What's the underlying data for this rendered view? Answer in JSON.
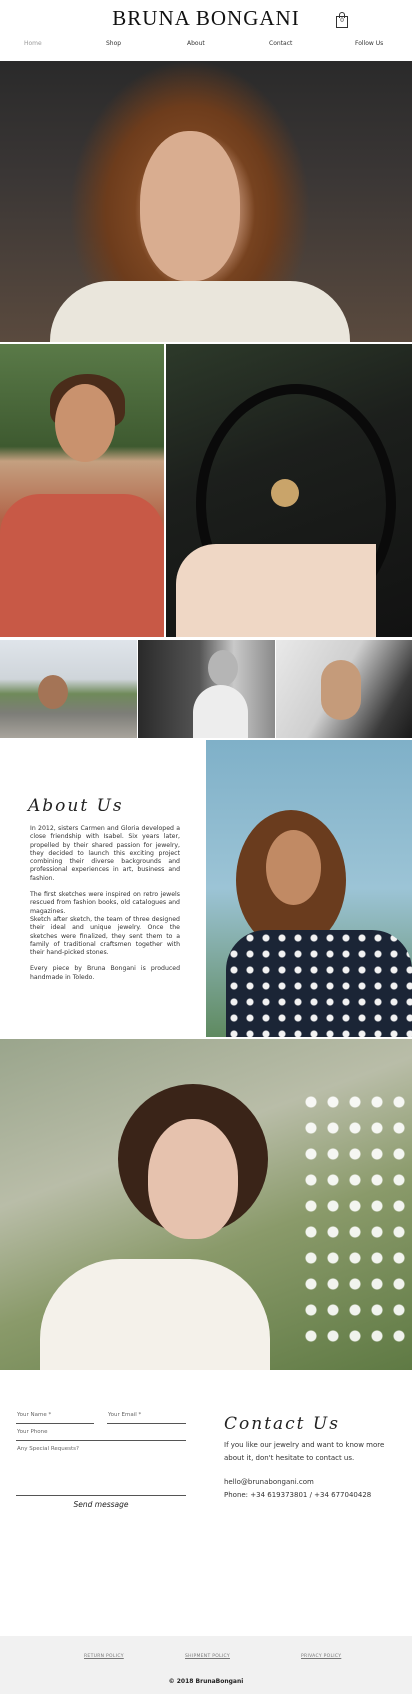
{
  "header": {
    "brand": "BRUNA BONGANI",
    "cart_count": "0",
    "nav": [
      "Home",
      "Shop",
      "About",
      "Contact",
      "Follow Us"
    ]
  },
  "about": {
    "title": "About Us",
    "paragraphs": [
      "In 2012, sisters Carmen and Gloria developed a close friendship with Isabel. Six years later, propelled by their shared passion for jewelry, they decided to launch this exciting project combining their diverse backgrounds and professional experiences in art, business and fashion.",
      "The first sketches were inspired on retro jewels rescued from fashion books, old catalogues and magazines.",
      "Sketch after sketch, the team of three designed their ideal and unique jewelry. Once the sketches were finalized, they sent them to a family of traditional craftsmen together with their hand-picked stones.",
      "Every piece by Bruna Bongani is produced handmade in Toledo."
    ]
  },
  "form": {
    "name_placeholder": "Your Name *",
    "email_placeholder": "Your Email *",
    "phone_placeholder": "Your Phone",
    "requests_placeholder": "Any Special Requests?",
    "send_label": "Send message"
  },
  "contact": {
    "title": "Contact Us",
    "text": "If you like our jewelry and want to know more about it, don't hesitate to contact us.",
    "email": "hello@brunabongani.com",
    "phone": "Phone: +34 619373801 / +34 677040428"
  },
  "footer": {
    "links": [
      "RETURN POLICY",
      "SHIPMENT POLICY",
      "PRIVACY POLICY"
    ],
    "copyright": "© 2018 BrunaBongani"
  }
}
